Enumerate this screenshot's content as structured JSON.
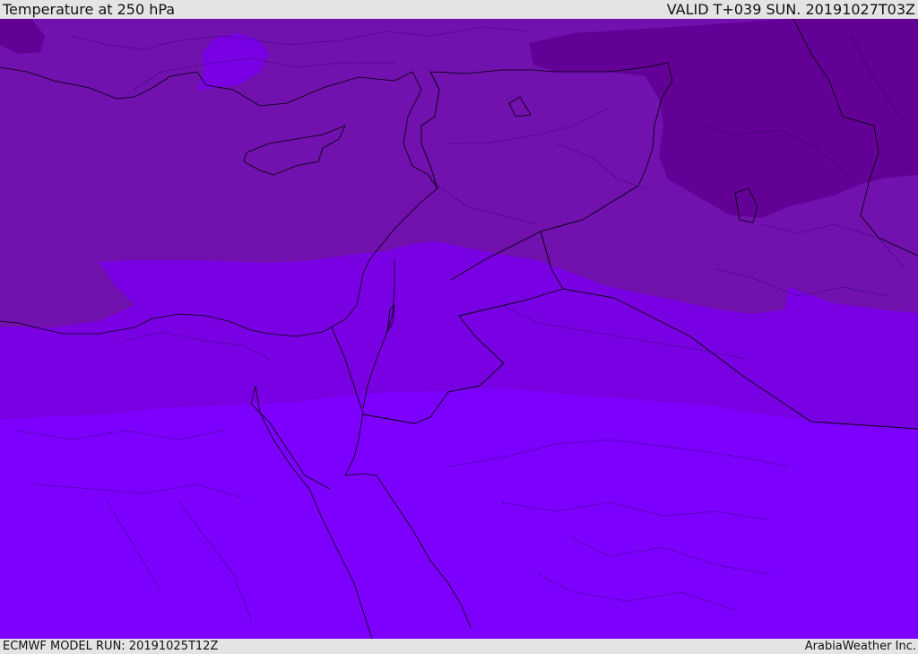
{
  "header": {
    "title": "Temperature at 250 hPa",
    "valid_time": "VALID T+039 SUN. 20191027T03Z"
  },
  "footer": {
    "model_run": "ECMWF MODEL RUN: 20191025T12Z",
    "credit": "ArabiaWeather Inc."
  },
  "map": {
    "field": "temperature",
    "level": "250 hPa",
    "colors": {
      "darkest": "#630095",
      "dark": "#7111ae",
      "mid": "#7a00e4",
      "light": "#7d00ff",
      "boundary_line": "#000000"
    }
  }
}
